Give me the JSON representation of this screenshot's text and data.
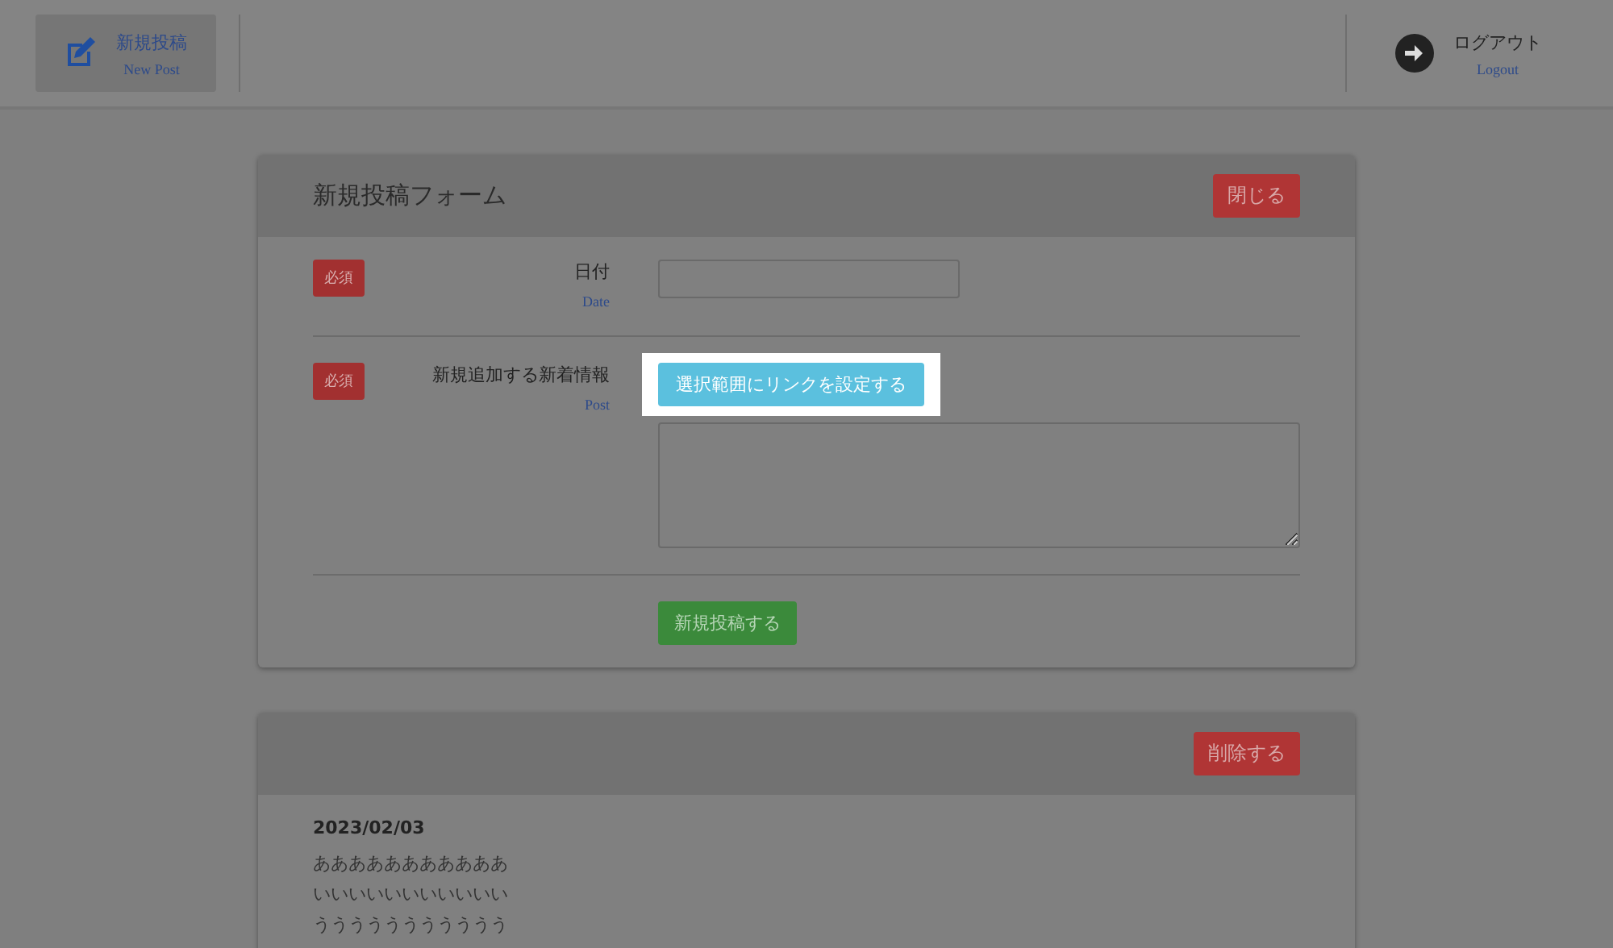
{
  "header": {
    "new_post": {
      "label": "新規投稿",
      "sublabel": "New Post"
    },
    "logout": {
      "label": "ログアウト",
      "sublabel": "Logout"
    }
  },
  "form": {
    "title": "新規投稿フォーム",
    "close_button": "閉じる",
    "fields": [
      {
        "kind": "date",
        "required": "必須",
        "label": "日付",
        "sublabel": "Date"
      },
      {
        "kind": "textarea",
        "required": "必須",
        "label": "新規追加する新着情報",
        "sublabel": "Post",
        "link_button": {
          "label": "選択範囲にリンクを設定する",
          "highlighted": true
        }
      }
    ],
    "submit_button": "新規投稿する"
  },
  "posts": [
    {
      "delete_button": "削除する",
      "date": "2023/02/03",
      "lines": [
        "あああああああああああ",
        "いいいいいいいいいいい",
        "ううううううううううう"
      ]
    }
  ]
}
